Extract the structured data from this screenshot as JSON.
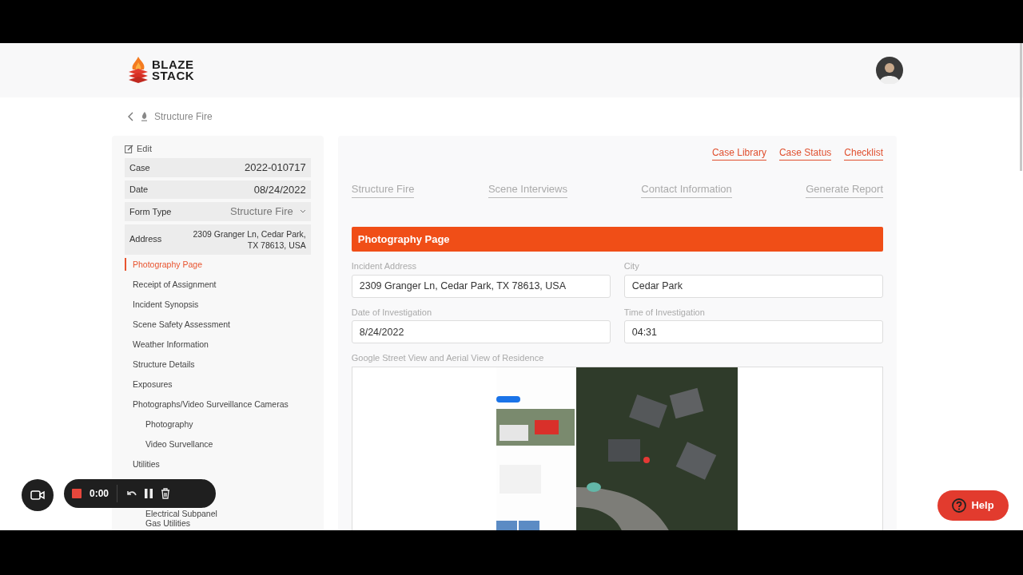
{
  "header": {
    "logo": [
      "BLAZE",
      "STACK"
    ]
  },
  "breadcrumb": {
    "title": "Structure Fire"
  },
  "case_card": {
    "edit": "Edit",
    "rows": [
      {
        "label": "Case",
        "value": "2022-010717",
        "kind": "text"
      },
      {
        "label": "Date",
        "value": "08/24/2022",
        "kind": "text"
      },
      {
        "label": "Form Type",
        "value": "Structure Fire",
        "kind": "select"
      },
      {
        "label": "Address",
        "value": "2309 Granger Ln, Cedar Park, TX 78613, USA",
        "kind": "text"
      }
    ]
  },
  "sidebar": {
    "items": [
      {
        "label": "Photography Page",
        "selected": true
      },
      {
        "label": "Receipt of Assignment",
        "selected": false
      },
      {
        "label": "Incident Synopsis",
        "selected": false
      },
      {
        "label": "Scene Safety Assessment",
        "selected": false
      },
      {
        "label": "Weather Information",
        "selected": false
      },
      {
        "label": "Structure Details",
        "selected": false
      },
      {
        "label": "Exposures",
        "selected": false
      },
      {
        "label": "Photographs/Video Surveillance Cameras",
        "selected": false,
        "children": [
          {
            "label": "Photography",
            "selected": false
          },
          {
            "label": "Video Survellance",
            "selected": false
          }
        ]
      },
      {
        "label": "Utilities",
        "selected": false,
        "children": [
          {
            "label": "Electrical Subpanel",
            "selected": false
          },
          {
            "label": "Gas Utilities",
            "selected": false
          }
        ]
      }
    ]
  },
  "top_links": [
    "Case Library",
    "Case Status",
    "Checklist"
  ],
  "tabs": [
    {
      "label": "Structure Fire",
      "selected": false
    },
    {
      "label": "Scene Interviews",
      "selected": false
    },
    {
      "label": "Contact Information",
      "selected": false
    },
    {
      "label": "Generate Report",
      "selected": false
    }
  ],
  "section": {
    "title": "Photography Page",
    "fields": [
      {
        "label": "Incident Address",
        "value": "2309 Granger Ln, Cedar Park, TX 78613, USA"
      },
      {
        "label": "City",
        "value": "Cedar Park"
      },
      {
        "label": "Date of Investigation",
        "value": "8/24/2022"
      },
      {
        "label": "Time of Investigation",
        "value": "04:31"
      }
    ],
    "photo_label": "Google Street View and Aerial View of Residence"
  },
  "recorder": {
    "time": "0:00"
  },
  "help": {
    "label": "Help"
  }
}
